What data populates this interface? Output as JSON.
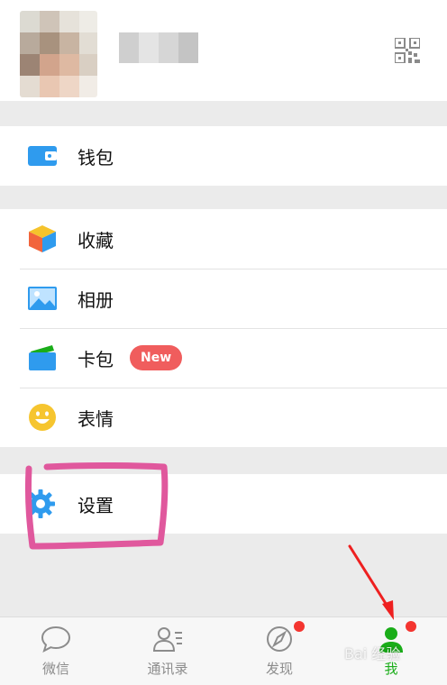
{
  "profile": {
    "avatar_icon": "blurred-avatar",
    "qr_icon": "qr-code-icon"
  },
  "menu": {
    "wallet": {
      "label": "钱包",
      "icon": "wallet-icon"
    },
    "favorites": {
      "label": "收藏",
      "icon": "cube-icon"
    },
    "album": {
      "label": "相册",
      "icon": "photo-icon"
    },
    "cards": {
      "label": "卡包",
      "icon": "card-icon",
      "badge": "New"
    },
    "stickers": {
      "label": "表情",
      "icon": "smiley-icon"
    },
    "settings": {
      "label": "设置",
      "icon": "gear-icon"
    }
  },
  "tabbar": {
    "tabs": [
      {
        "label": "微信",
        "icon": "chat-bubble-icon"
      },
      {
        "label": "通讯录",
        "icon": "contacts-icon"
      },
      {
        "label": "发现",
        "icon": "compass-icon"
      },
      {
        "label": "我",
        "icon": "person-icon"
      }
    ]
  },
  "colors": {
    "accent_green": "#1aad19",
    "badge_red": "#f05d5d",
    "annotation_pink": "#e0589d",
    "annotation_red": "#ee2020"
  }
}
